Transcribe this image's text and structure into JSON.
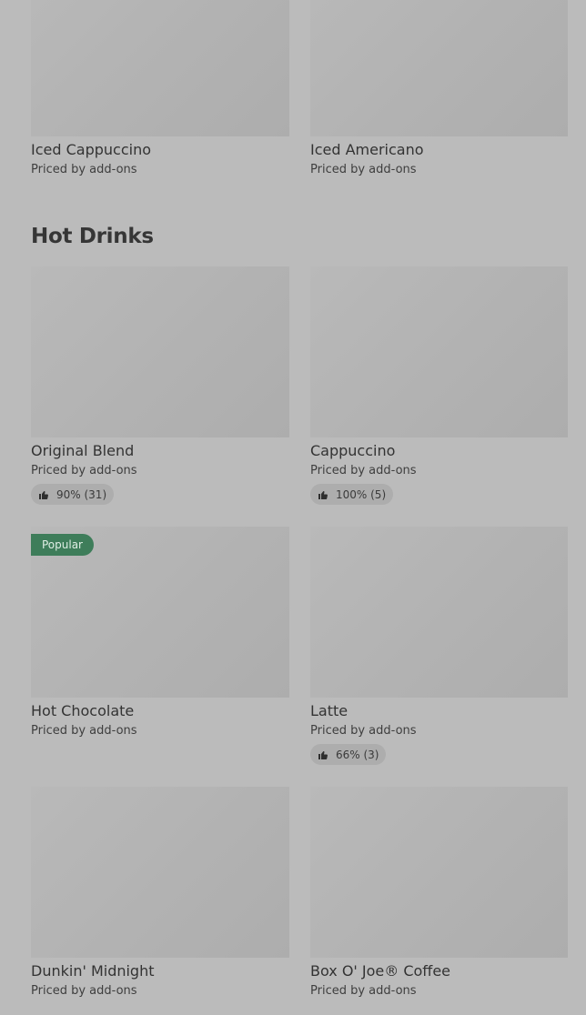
{
  "colors": {
    "background": "#bbbbbb",
    "popular_badge": "#3e7d5a",
    "rating_pill": "#adadad"
  },
  "sections": {
    "hot_drinks_title": "Hot Drinks"
  },
  "items": [
    {
      "name": "Iced Cappuccino",
      "price_note": "Priced by add-ons"
    },
    {
      "name": "Iced Americano",
      "price_note": "Priced by add-ons"
    },
    {
      "name": "Original Blend",
      "price_note": "Priced by add-ons",
      "rating": "90% (31)",
      "icon": "thumbs-up-icon"
    },
    {
      "name": "Cappuccino",
      "price_note": "Priced by add-ons",
      "rating": "100% (5)",
      "icon": "thumbs-up-icon"
    },
    {
      "name": "Hot Chocolate",
      "price_note": "Priced by add-ons",
      "badge": "Popular"
    },
    {
      "name": "Latte",
      "price_note": "Priced by add-ons",
      "rating": "66% (3)",
      "icon": "thumbs-up-icon"
    },
    {
      "name": "Dunkin' Midnight",
      "price_note": "Priced by add-ons"
    },
    {
      "name": "Box O' Joe® Coffee",
      "price_note": "Priced by add-ons"
    }
  ]
}
